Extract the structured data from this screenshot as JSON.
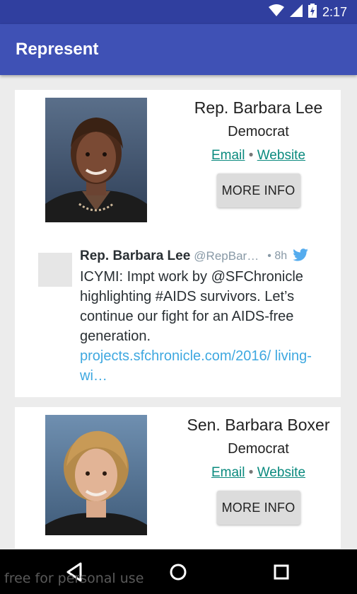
{
  "status_bar": {
    "time": "2:17",
    "icons": [
      "wifi-icon",
      "signal-icon",
      "battery-charging-icon"
    ]
  },
  "app_bar": {
    "title": "Represent"
  },
  "representatives": [
    {
      "name": "Rep. Barbara Lee",
      "party": "Democrat",
      "email_label": "Email",
      "separator": "•",
      "website_label": "Website",
      "more_info_label": "MORE INFO"
    },
    {
      "name": "Sen. Barbara Boxer",
      "party": "Democrat",
      "email_label": "Email",
      "separator": "•",
      "website_label": "Website",
      "more_info_label": "MORE INFO"
    }
  ],
  "tweet": {
    "author": "Rep. Barbara Lee",
    "handle": "@RepBarb…",
    "time": "• 8h",
    "text": "ICYMI: Impt work by @SFChronicle highlighting #AIDS survivors. Let’s continue our fight for an AIDS-free generation.",
    "link": "projects.sfchronicle.com/2016/ living-wi…"
  },
  "watermark": "free for personal use",
  "colors": {
    "status_bar": "#303f9f",
    "app_bar": "#3f51b5",
    "link": "#0a8a7e",
    "tweet_link": "#3ea8e0",
    "twitter_blue": "#55acee"
  },
  "nav_bar": {
    "icons": [
      "back-icon",
      "home-icon",
      "recents-icon"
    ]
  }
}
